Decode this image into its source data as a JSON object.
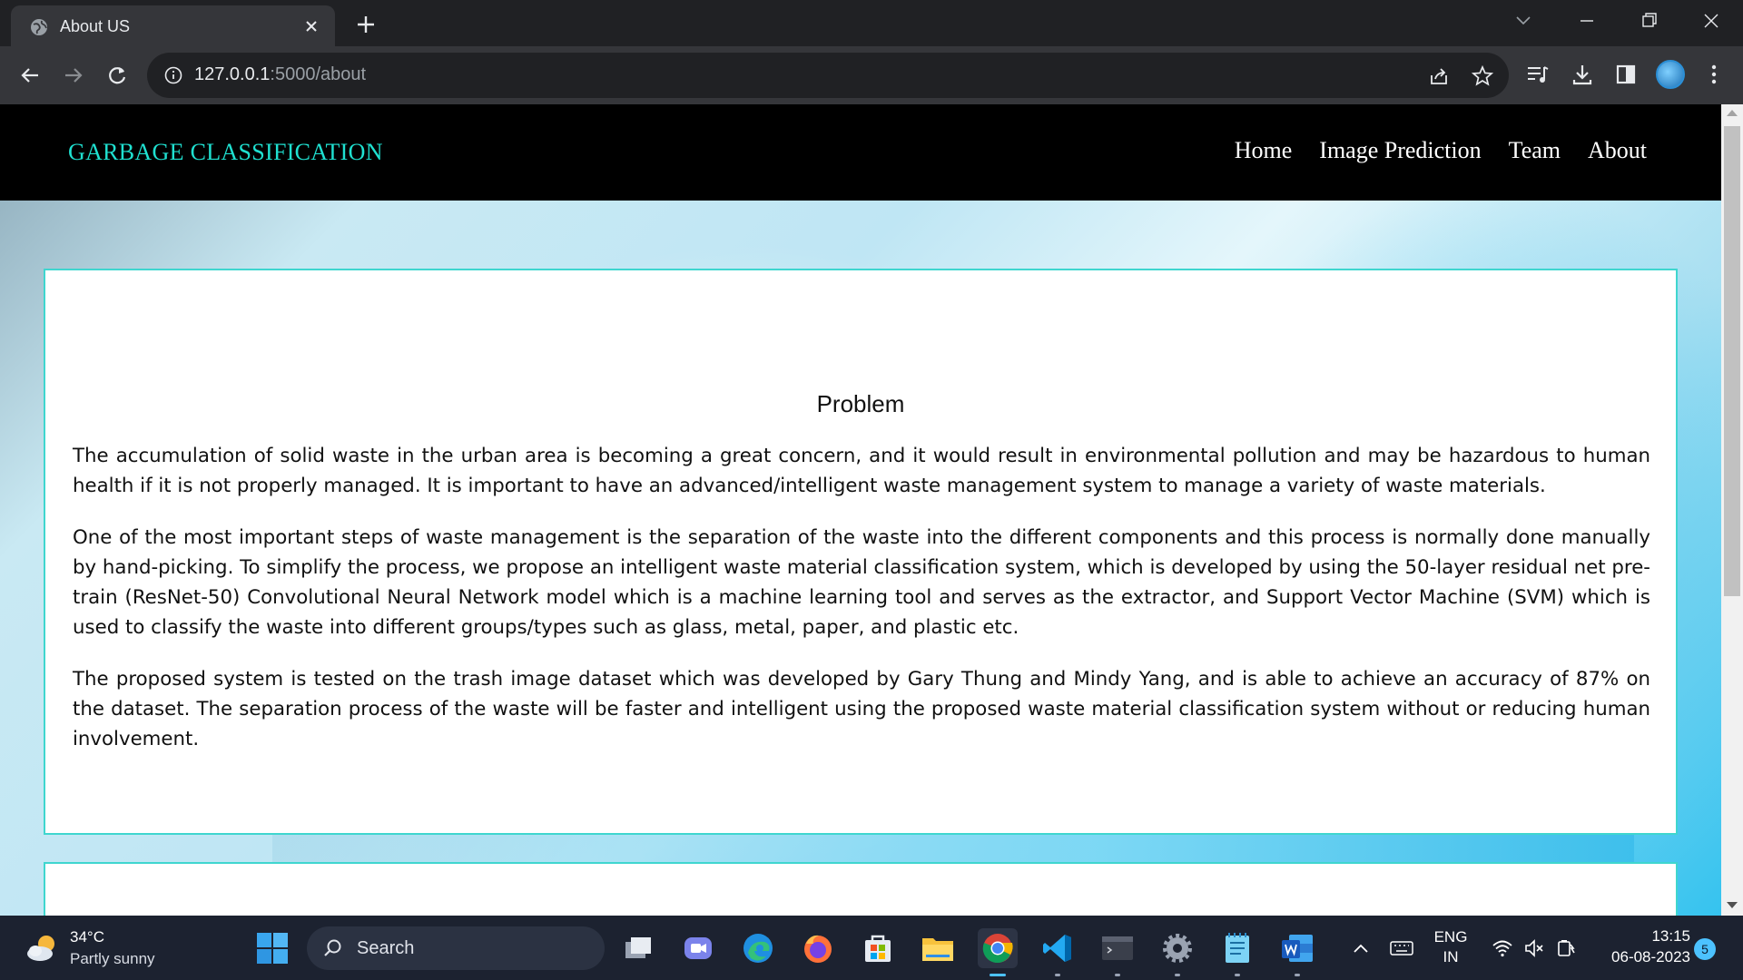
{
  "browser": {
    "tab_title": "About US",
    "url_host": "127.0.0.1",
    "url_path": ":5000/about"
  },
  "site": {
    "brand": "GARBAGE CLASSIFICATION",
    "nav": [
      "Home",
      "Image Prediction",
      "Team",
      "About"
    ]
  },
  "article": {
    "heading": "Problem",
    "paragraphs": [
      "The accumulation of solid waste in the urban area is becoming a great concern, and it would result in environmental pollution and may be hazardous to human health if it is not properly managed. It is important to have an advanced/intelligent waste management system to manage a variety of waste materials.",
      "One of the most important steps of waste management is the separation of the waste into the different components and this process is normally done manually by hand-picking. To simplify the process, we propose an intelligent waste material classification system, which is developed by using the 50-layer residual net pre-train (ResNet-50) Convolutional Neural Network model which is a machine learning tool and serves as the extractor, and Support Vector Machine (SVM) which is used to classify the waste into different groups/types such as glass, metal, paper, and plastic etc.",
      "The proposed system is tested on the trash image dataset which was developed by Gary Thung and Mindy Yang, and is able to achieve an accuracy of 87% on the dataset. The separation process of the waste will be faster and intelligent using the proposed waste material classification system without or reducing human involvement."
    ]
  },
  "taskbar": {
    "weather_temp": "34°C",
    "weather_desc": "Partly sunny",
    "search_label": "Search",
    "lang_line1": "ENG",
    "lang_line2": "IN",
    "time": "13:15",
    "date": "06-08-2023",
    "notification_count": "5"
  },
  "colors": {
    "brand": "#1fe0d0",
    "card_border": "#3fd6cf",
    "nav_bg": "#000000"
  }
}
